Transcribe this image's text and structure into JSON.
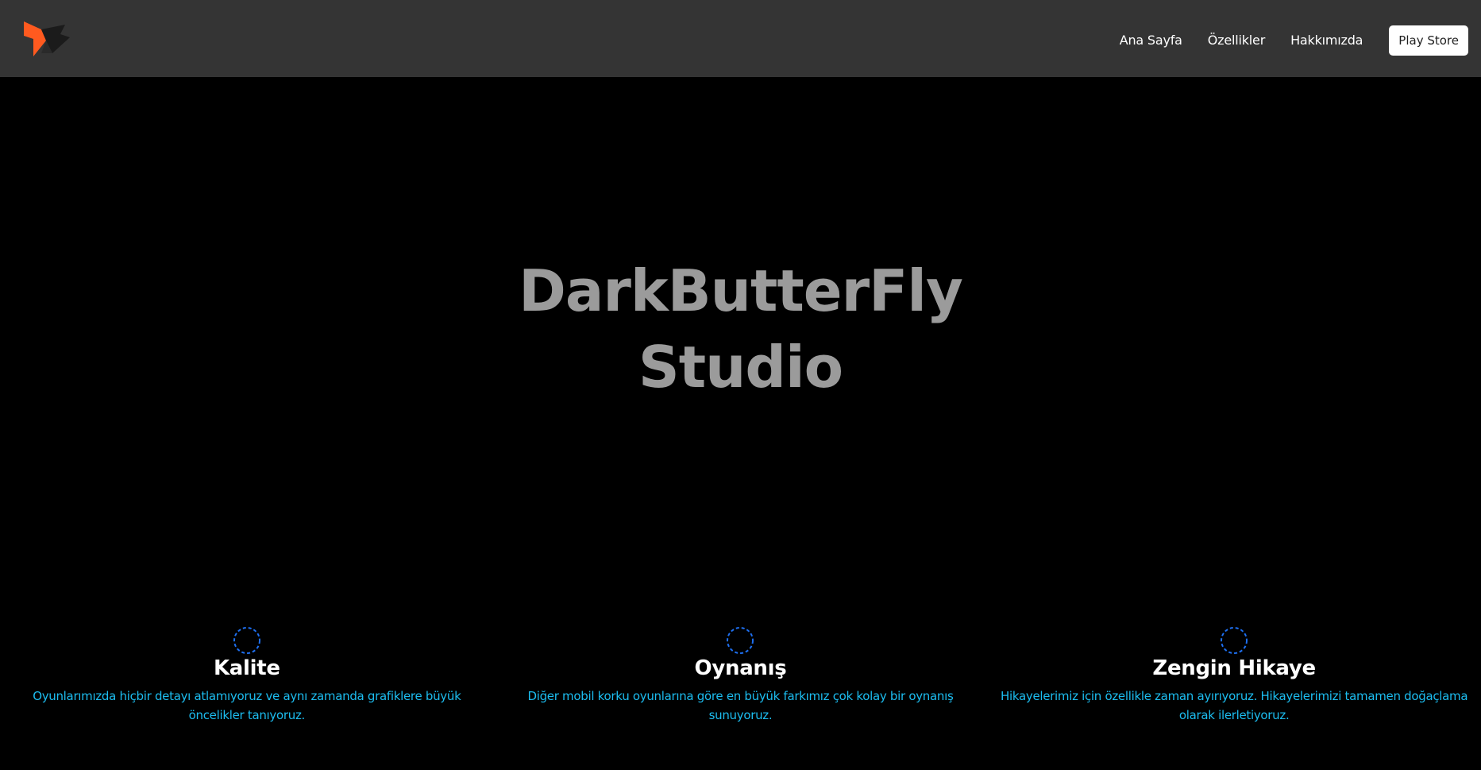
{
  "navbar": {
    "logo_icon": "butterfly-logo-icon",
    "links": [
      {
        "label": "Ana Sayfa"
      },
      {
        "label": "Özellikler"
      },
      {
        "label": "Hakkımızda"
      }
    ],
    "cta_label": "Play Store"
  },
  "hero": {
    "title_line1": "DarkButterFly",
    "title_line2": "Studio"
  },
  "features": [
    {
      "icon": "spinner-icon",
      "title": "Kalite",
      "description": "Oyunlarımızda hiçbir detayı atlamıyoruz ve aynı zamanda grafiklere büyük öncelikler tanıyoruz."
    },
    {
      "icon": "spinner-icon",
      "title": "Oynanış",
      "description": "Diğer mobil korku oyunlarına göre en büyük farkımız çok kolay bir oynanış sunuyoruz."
    },
    {
      "icon": "spinner-icon",
      "title": "Zengin Hikaye",
      "description": "Hikayelerimiz için özellikle zaman ayırıyoruz. Hikayelerimizi tamamen doğaçlama olarak ilerletiyoruz."
    }
  ],
  "colors": {
    "navbar_bg": "#343434",
    "page_bg": "#000000",
    "hero_text": "#9b9b9b",
    "feature_desc": "#1cbdf0",
    "spinner": "#1e6ff0",
    "logo_orange": "#ff5a1f"
  }
}
